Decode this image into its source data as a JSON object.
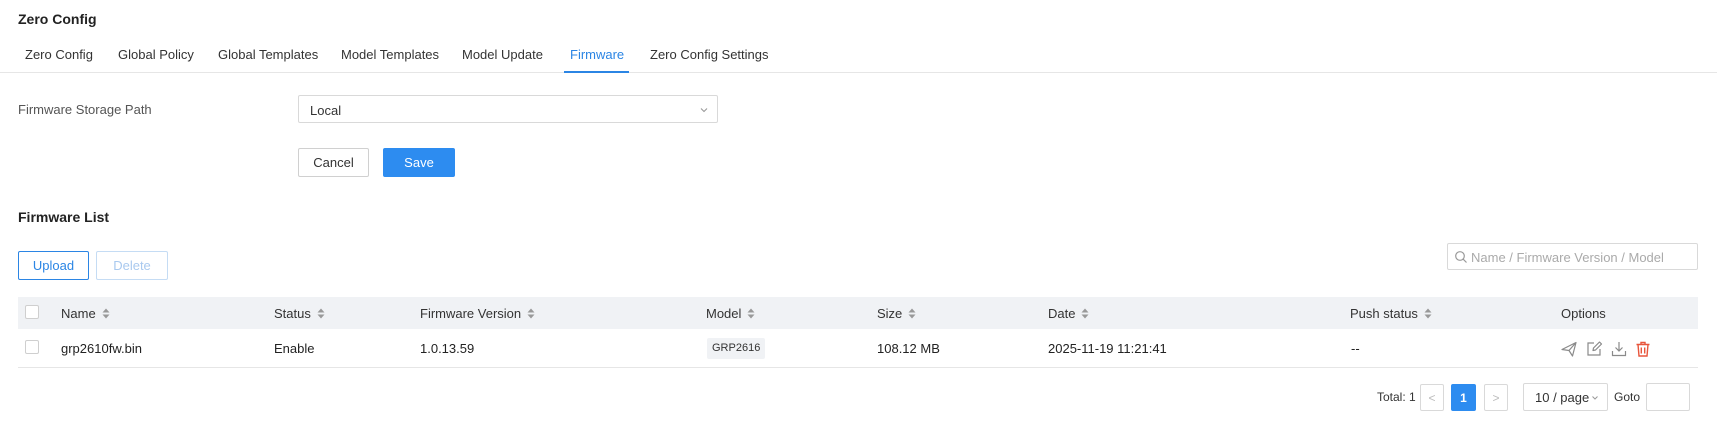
{
  "page_title": "Zero Config",
  "tabs": [
    {
      "label": "Zero Config"
    },
    {
      "label": "Global Policy"
    },
    {
      "label": "Global Templates"
    },
    {
      "label": "Model Templates"
    },
    {
      "label": "Model Update"
    },
    {
      "label": "Firmware",
      "active": true
    },
    {
      "label": "Zero Config Settings"
    }
  ],
  "storage": {
    "label": "Firmware Storage Path",
    "value": "Local",
    "cancel_label": "Cancel",
    "save_label": "Save"
  },
  "firmware_list": {
    "title": "Firmware List",
    "upload_label": "Upload",
    "delete_label": "Delete",
    "search_placeholder": "Name / Firmware Version / Model",
    "columns": [
      "Name",
      "Status",
      "Firmware Version",
      "Model",
      "Size",
      "Date",
      "Push status",
      "Options"
    ],
    "rows": [
      {
        "name": "grp2610fw.bin",
        "status": "Enable",
        "firmware_version": "1.0.13.59",
        "model": "GRP2616",
        "size": "108.12 MB",
        "date": "2025-11-19 11:21:41",
        "push_status": "--"
      }
    ]
  },
  "pagination": {
    "total_label": "Total: 1",
    "prev": "<",
    "current_page": "1",
    "next": ">",
    "page_size": "10 / page",
    "goto_label": "Goto",
    "goto_value": ""
  },
  "colors": {
    "accent": "#2d8cf0",
    "delete_icon": "#e8553b",
    "header_bg": "#f0f2f5"
  },
  "icons": {
    "options": [
      "send-icon",
      "edit-icon",
      "download-icon",
      "trash-icon"
    ]
  }
}
